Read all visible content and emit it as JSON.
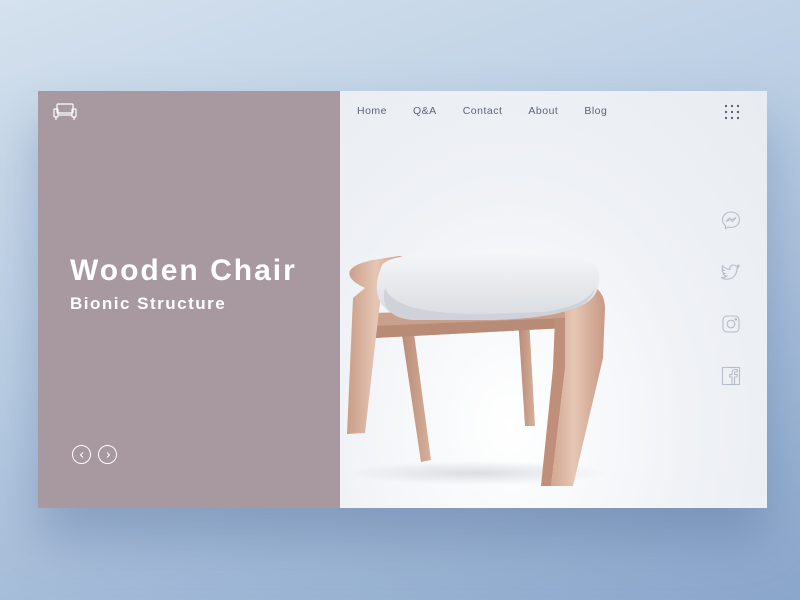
{
  "header": {
    "logo_icon": "sofa-icon",
    "nav": [
      {
        "label": "Home"
      },
      {
        "label": "Q&A"
      },
      {
        "label": "Contact"
      },
      {
        "label": "About"
      },
      {
        "label": "Blog"
      }
    ],
    "menu_icon": "grid-dots-icon"
  },
  "hero": {
    "title": "Wooden Chair",
    "subtitle": "Bionic Structure",
    "prev_icon": "chevron-left-icon",
    "next_icon": "chevron-right-icon"
  },
  "social": [
    {
      "icon": "messenger-icon"
    },
    {
      "icon": "twitter-icon"
    },
    {
      "icon": "instagram-icon"
    },
    {
      "icon": "facebook-icon"
    }
  ],
  "colors": {
    "left_panel": "#a898a0",
    "right_panel": "#eef1f5",
    "nav_text": "#5a6478",
    "hero_text": "#ffffff",
    "icon_muted": "#b7bec9",
    "wood": "#d9b6a3",
    "cushion": "#e9ebee"
  }
}
